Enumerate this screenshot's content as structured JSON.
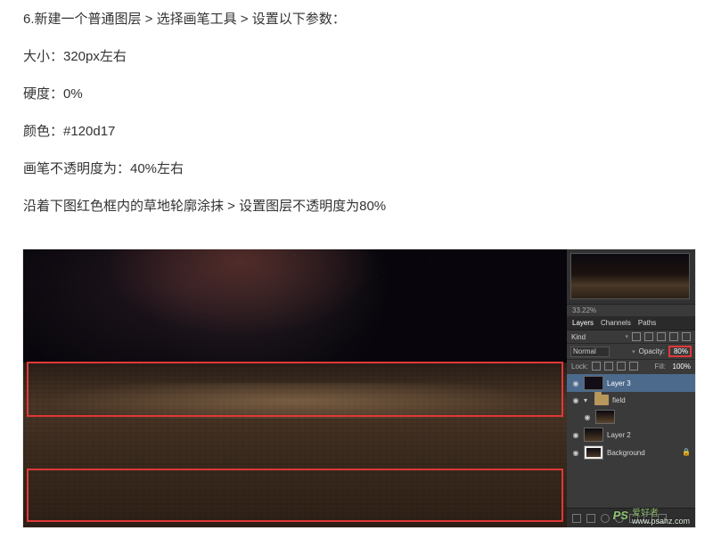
{
  "text": {
    "step_intro": "6.新建一个普通图层 > 选择画笔工具 > 设置以下参数：",
    "size": "大小：320px左右",
    "hardness": "硬度：0%",
    "color": "颜色：#120d17",
    "opacity_brush": "画笔不透明度为：40%左右",
    "instruction": "沿着下图红色框内的草地轮廓涂抹 > 设置图层不透明度为80%"
  },
  "panel": {
    "nav_zoom": "33.22%",
    "tabs": {
      "layers": "Layers",
      "channels": "Channels",
      "paths": "Paths"
    },
    "kind": "Kind",
    "blend_mode": "Normal",
    "opacity_label": "Opacity:",
    "opacity_value": "80%",
    "lock_label": "Lock:",
    "fill_label": "Fill:",
    "fill_value": "100%",
    "layers": {
      "l3": "Layer 3",
      "field": "field",
      "l2": "Layer 2",
      "bg": "Background"
    }
  },
  "watermark": {
    "brand": "PS",
    "brand_cn": "爱好者",
    "url": "www.psahz.com"
  }
}
